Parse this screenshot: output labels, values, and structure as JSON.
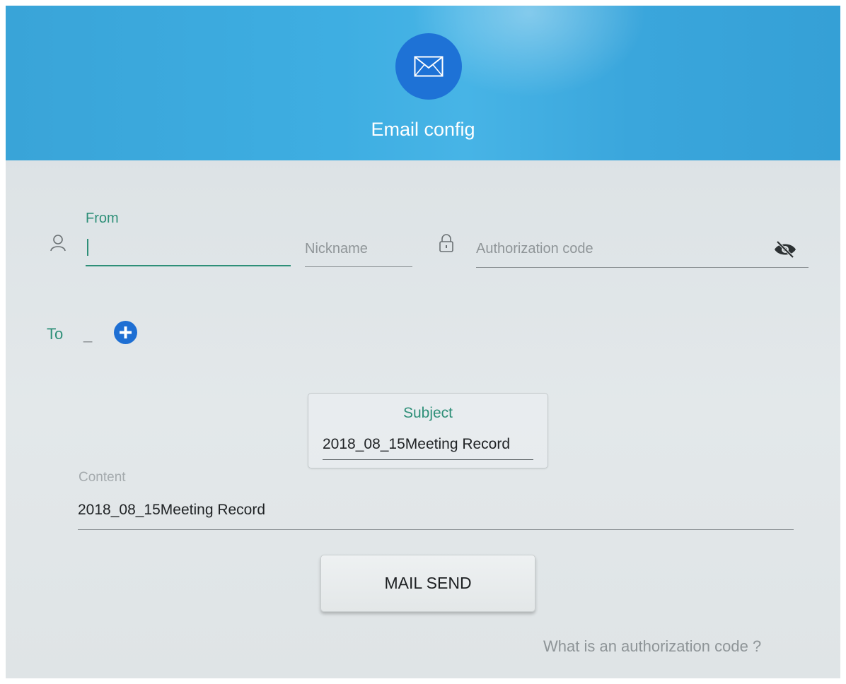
{
  "header": {
    "title": "Email config",
    "icon": "mail-icon",
    "accent_color": "#1e72d6"
  },
  "from_field": {
    "label": "From",
    "value": "",
    "icon": "user-icon"
  },
  "nickname_field": {
    "placeholder": "Nickname",
    "value": ""
  },
  "auth_field": {
    "placeholder": "Authorization code",
    "value": "",
    "lock_icon": "lock-icon",
    "visibility_icon": "eye-off-icon"
  },
  "to_field": {
    "label": "To",
    "value": "_",
    "add_icon": "plus-circle-icon"
  },
  "subject_field": {
    "label": "Subject",
    "value": "2018_08_15Meeting Record"
  },
  "content_field": {
    "label": "Content",
    "value": "2018_08_15Meeting Record"
  },
  "send_button": {
    "label": "MAIL SEND"
  },
  "help_link": {
    "text": "What is an authorization code ?"
  },
  "colors": {
    "header_blue": "#3eaee2",
    "label_green": "#2e8f78",
    "add_button_blue": "#1e6fd3"
  }
}
